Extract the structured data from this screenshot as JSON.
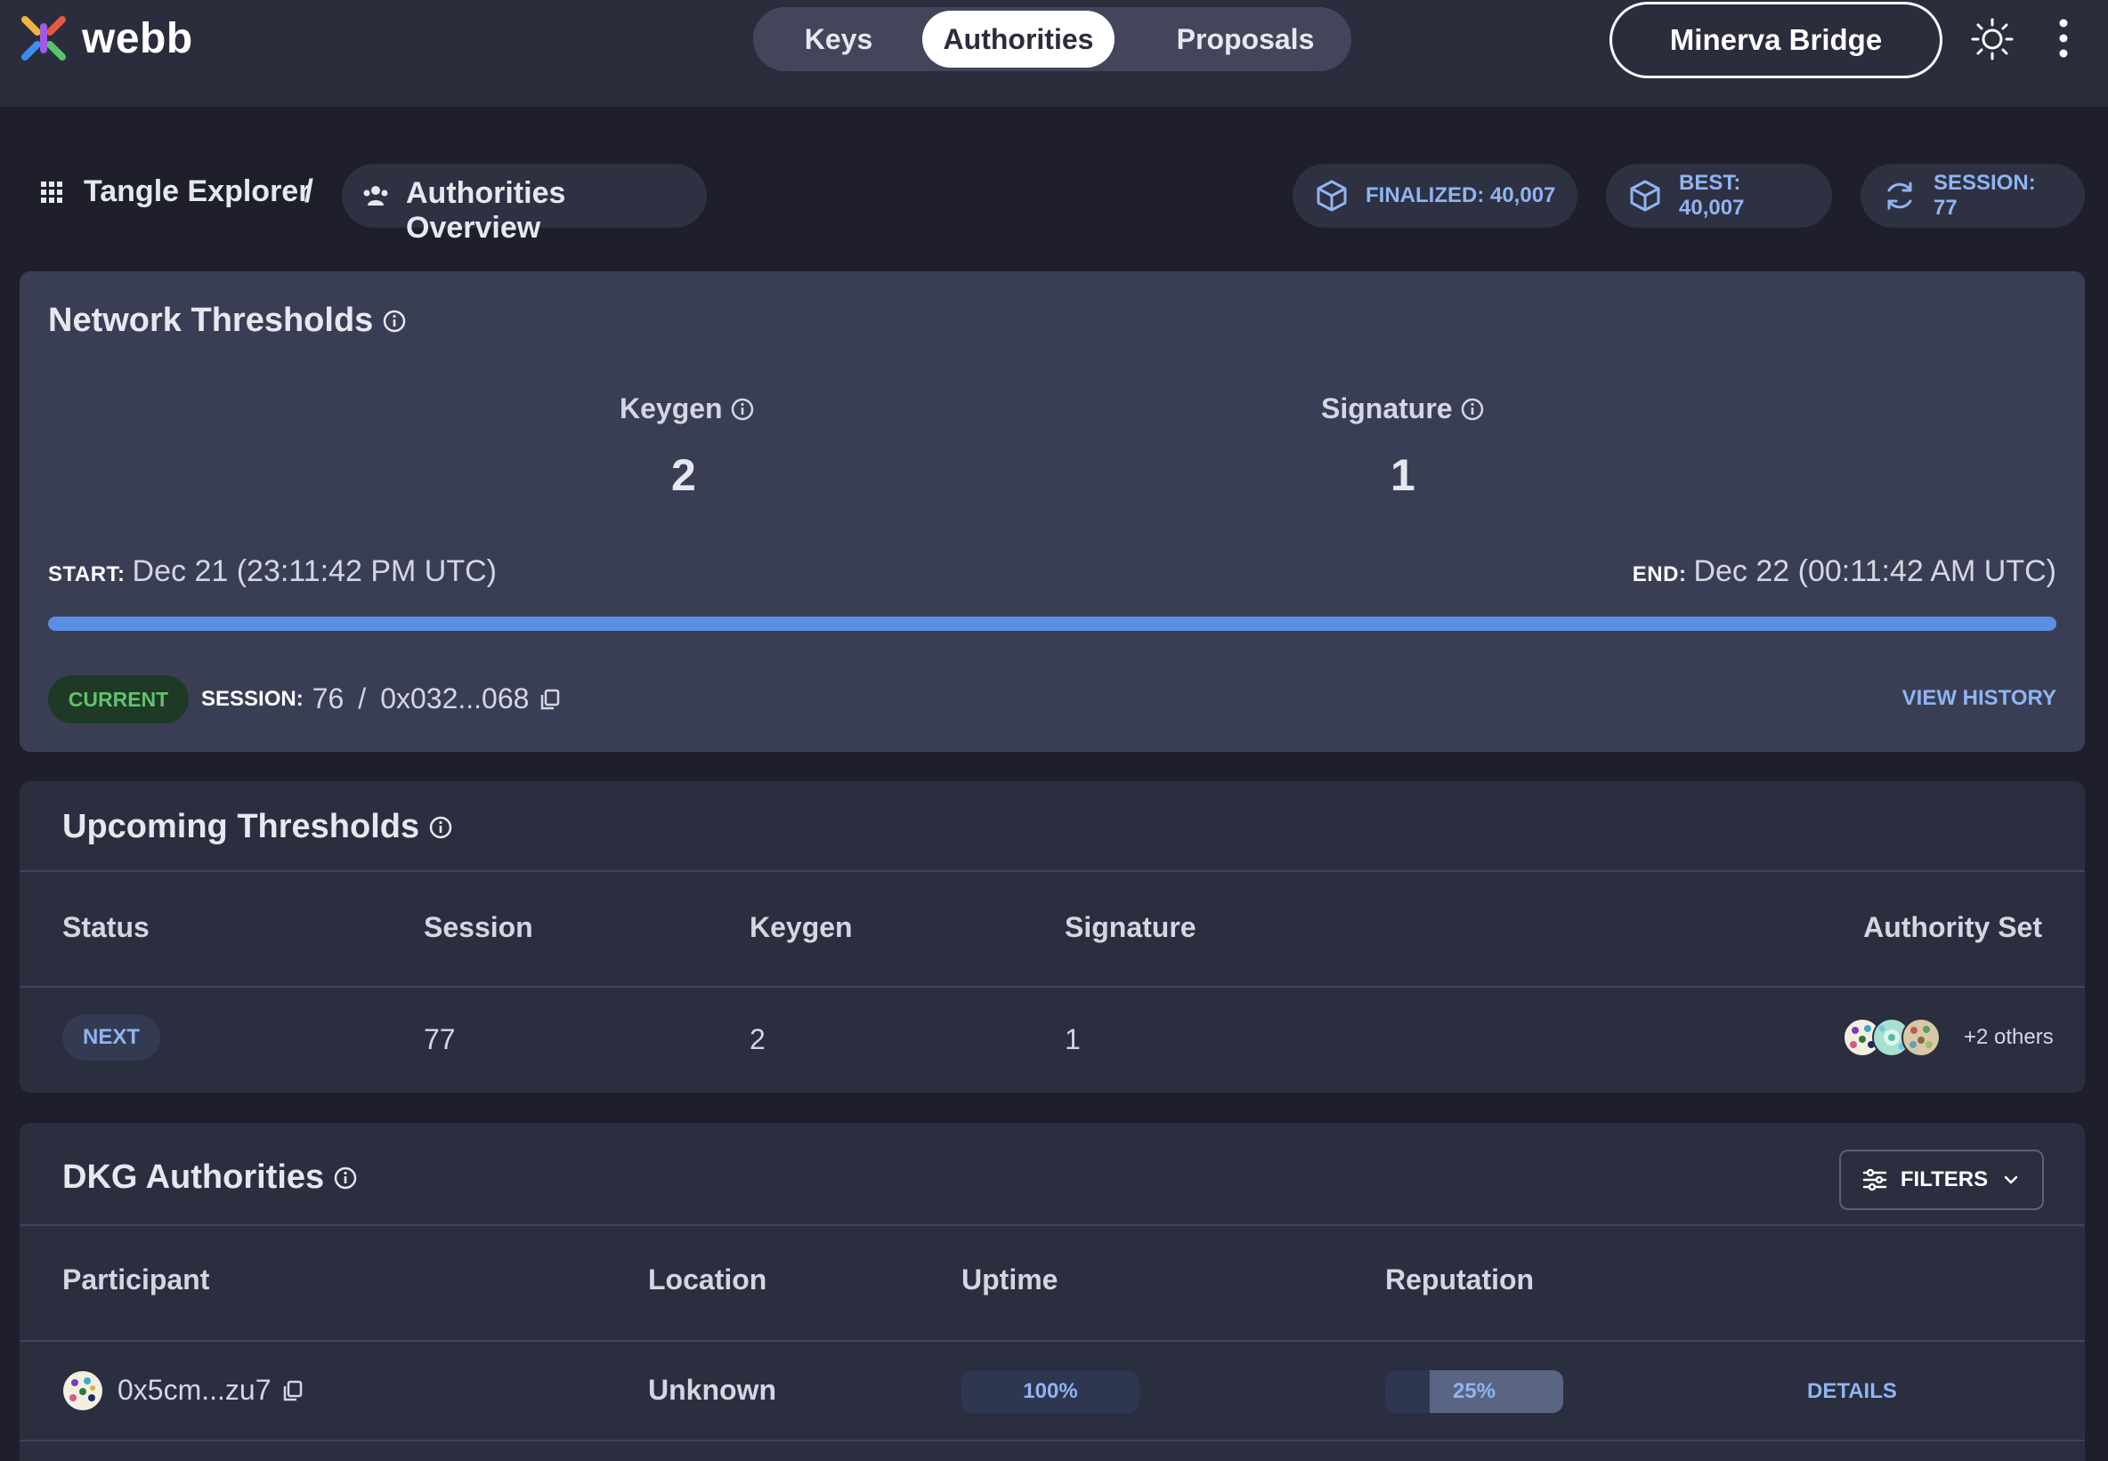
{
  "app": {
    "logo_text": "webb"
  },
  "nav": {
    "tabs": [
      {
        "label": "Keys"
      },
      {
        "label": "Authorities"
      },
      {
        "label": "Proposals"
      }
    ],
    "active": "Authorities"
  },
  "header": {
    "network_button": "Minerva Bridge"
  },
  "breadcrumb": {
    "root": "Tangle Explorer",
    "separator": "/",
    "current": "Authorities Overview"
  },
  "stats": {
    "finalized": "FINALIZED: 40,007",
    "best": "BEST: 40,007",
    "session": "SESSION: 77"
  },
  "network_thresholds": {
    "title": "Network Thresholds",
    "keygen_label": "Keygen",
    "keygen_value": "2",
    "signature_label": "Signature",
    "signature_value": "1",
    "start_label": "START:",
    "start_value": "Dec 21 (23:11:42 PM UTC)",
    "end_label": "END:",
    "end_value": "Dec 22 (00:11:42 AM UTC)",
    "progress_percent": 100,
    "status_badge": "CURRENT",
    "session_label": "SESSION:",
    "session_number": "76",
    "session_sep": "/",
    "session_hash": "0x032...068",
    "view_history": "VIEW HISTORY"
  },
  "upcoming_thresholds": {
    "title": "Upcoming Thresholds",
    "columns": [
      "Status",
      "Session",
      "Keygen",
      "Signature",
      "Authority Set"
    ],
    "rows": [
      {
        "status": "NEXT",
        "session": "77",
        "keygen": "2",
        "signature": "1",
        "others": "+2 others"
      }
    ]
  },
  "dkg_authorities": {
    "title": "DKG Authorities",
    "filters_label": "FILTERS",
    "columns": [
      "Participant",
      "Location",
      "Uptime",
      "Reputation"
    ],
    "rows": [
      {
        "participant": "0x5cm...zu7",
        "location": "Unknown",
        "uptime": "100%",
        "uptime_value": 100,
        "reputation": "25%",
        "reputation_value": 25,
        "action": "DETAILS"
      }
    ]
  },
  "colors": {
    "accent": "#5b8fe6",
    "link": "#8fb4f2",
    "success": "#63c16f"
  },
  "icons": [
    "webb-logo",
    "sun-icon",
    "kebab-icon",
    "grid-icon",
    "users-icon",
    "cube-icon",
    "refresh-icon",
    "info-icon",
    "copy-icon",
    "filter-icon",
    "chevron-down-icon"
  ]
}
